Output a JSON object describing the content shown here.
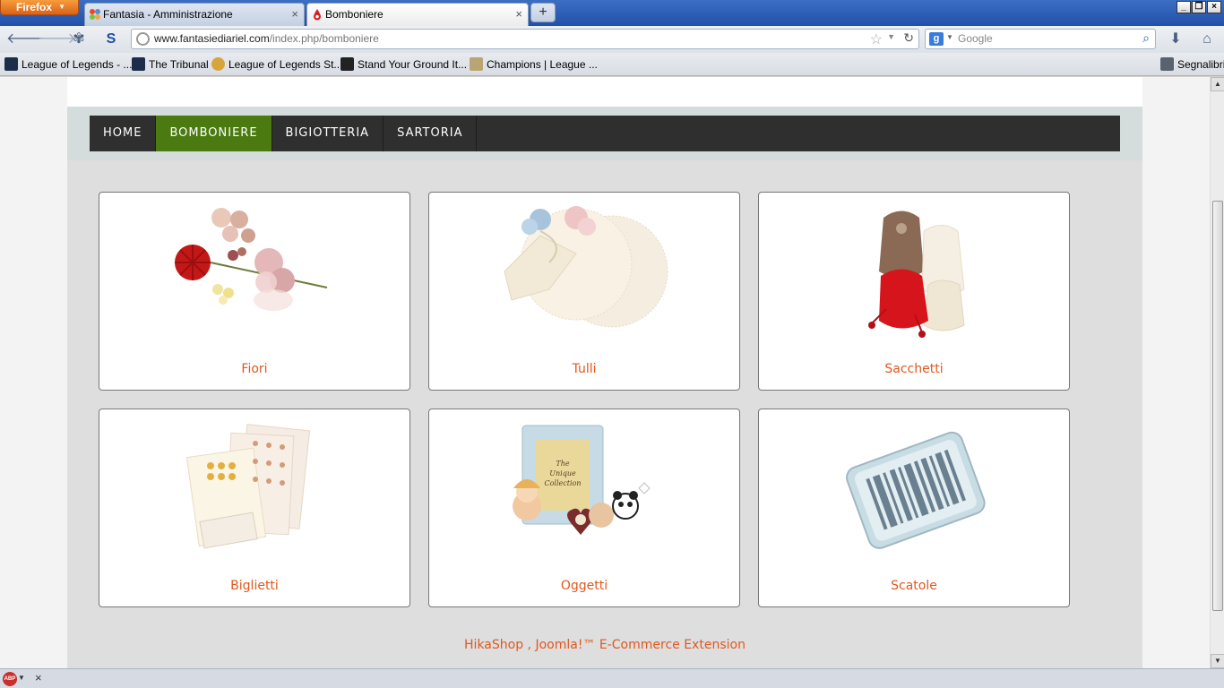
{
  "browser": {
    "app_button": "Firefox",
    "tabs": [
      {
        "title": "Fantasia - Amministrazione",
        "active": false
      },
      {
        "title": "Bomboniere",
        "active": true
      }
    ],
    "url_domain": "www.fantasiediariel.com",
    "url_path": "/index.php/bomboniere",
    "search_placeholder": "Google",
    "bookmarks": [
      "League of Legends - ...",
      "The Tribunal",
      "League of Legends St...",
      "Stand Your Ground It...",
      "Champions | League ..."
    ],
    "bookmarks_menu": "Segnalibri"
  },
  "site": {
    "menu": [
      {
        "label": "HOME",
        "active": false
      },
      {
        "label": "BOMBONIERE",
        "active": true
      },
      {
        "label": "BIGIOTTERIA",
        "active": false
      },
      {
        "label": "SARTORIA",
        "active": false
      }
    ],
    "categories": [
      {
        "label": "Fiori",
        "icon": "flowers-image"
      },
      {
        "label": "Tulli",
        "icon": "tulle-image"
      },
      {
        "label": "Sacchetti",
        "icon": "bags-image"
      },
      {
        "label": "Biglietti",
        "icon": "cards-image"
      },
      {
        "label": "Oggetti",
        "icon": "objects-image"
      },
      {
        "label": "Scatole",
        "icon": "barcode-box-image"
      }
    ],
    "footer_link": "HikaShop , Joomla!™ E-Commerce Extension"
  },
  "colors": {
    "menu_active": "#4a7a10",
    "link": "#e0581e"
  }
}
